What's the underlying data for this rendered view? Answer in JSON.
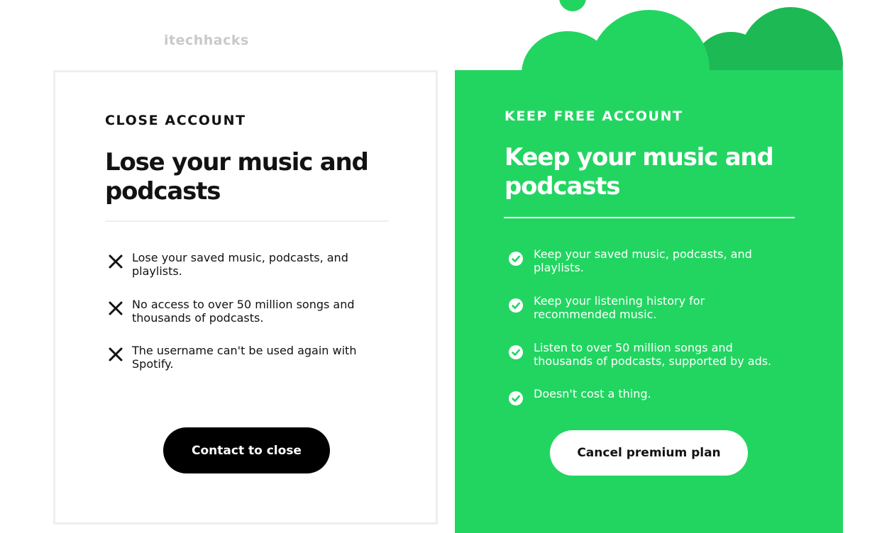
{
  "watermark": "itechhacks",
  "close_card": {
    "eyebrow": "CLOSE ACCOUNT",
    "headline_line1": "Lose your music and",
    "headline_line2": "podcasts",
    "features": [
      {
        "icon": "x-icon",
        "line1": "Lose your saved music, podcasts, and",
        "line2": "playlists."
      },
      {
        "icon": "x-icon",
        "line1": "No access to over 50 million songs and",
        "line2": "thousands of podcasts."
      },
      {
        "icon": "x-icon",
        "line1": "The username can't be used again with",
        "line2": "Spotify."
      }
    ],
    "button_label": "Contact to close"
  },
  "keep_card": {
    "eyebrow": "KEEP FREE ACCOUNT",
    "headline_line1": "Keep your music and",
    "headline_line2": "podcasts",
    "features": [
      {
        "icon": "check-circle-icon",
        "line1": "Keep your saved music, podcasts, and",
        "line2": "playlists."
      },
      {
        "icon": "check-circle-icon",
        "line1": "Keep your listening history for",
        "line2": "recommended music."
      },
      {
        "icon": "check-circle-icon",
        "line1": "Listen to over 50 million songs and",
        "line2": "thousands of podcasts, supported by ads."
      },
      {
        "icon": "check-circle-icon",
        "line1": "Doesn't cost a thing.",
        "line2": ""
      }
    ],
    "button_label": "Cancel premium plan"
  },
  "colors": {
    "spotify_green": "#22d561",
    "dark_green": "#1db954",
    "text_dark": "#121212",
    "button_dark": "#000000",
    "card_border": "#eeeeee"
  }
}
